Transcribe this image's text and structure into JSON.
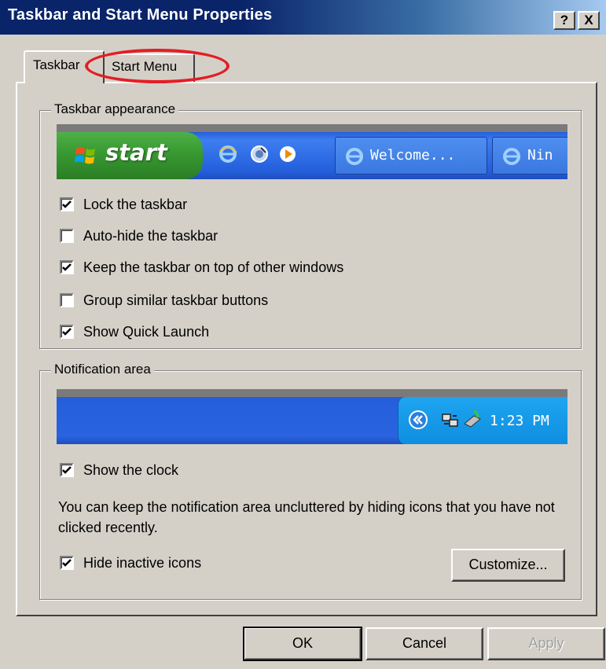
{
  "window": {
    "title": "Taskbar and Start Menu Properties",
    "help_label": "?",
    "close_label": "X"
  },
  "tabs": [
    {
      "label": "Taskbar",
      "selected": true
    },
    {
      "label": "Start Menu",
      "selected": false
    }
  ],
  "taskbar_appearance": {
    "group_label": "Taskbar appearance",
    "preview": {
      "start_label": "start",
      "quick_launch_icons": [
        "ie-icon",
        "media-icon",
        "player-icon"
      ],
      "task_buttons": [
        "Welcome...",
        "Nin"
      ]
    },
    "options": [
      {
        "label": "Lock the taskbar",
        "checked": true
      },
      {
        "label": "Auto-hide the taskbar",
        "checked": false
      },
      {
        "label": "Keep the taskbar on top of other windows",
        "checked": true
      },
      {
        "label": "Group similar taskbar buttons",
        "checked": false
      },
      {
        "label": "Show Quick Launch",
        "checked": true
      }
    ]
  },
  "notification_area": {
    "group_label": "Notification area",
    "preview": {
      "clock": "1:23 PM",
      "tray_icons": [
        "chevron-left-icon",
        "network-icon",
        "usb-icon"
      ]
    },
    "show_clock": {
      "label": "Show the clock",
      "checked": true
    },
    "info_text": "You can keep the notification area uncluttered by hiding icons that you have not clicked recently.",
    "hide_inactive": {
      "label": "Hide inactive icons",
      "checked": true
    },
    "customize_label": "Customize..."
  },
  "buttons": {
    "ok": "OK",
    "cancel": "Cancel",
    "apply": "Apply"
  },
  "colors": {
    "dialog_bg": "#d4d0c8",
    "titlebar": "#0a246a",
    "annotation_red": "#e31e24",
    "xp_taskbar_blue": "#245edb",
    "xp_start_green": "#3a9b33"
  }
}
